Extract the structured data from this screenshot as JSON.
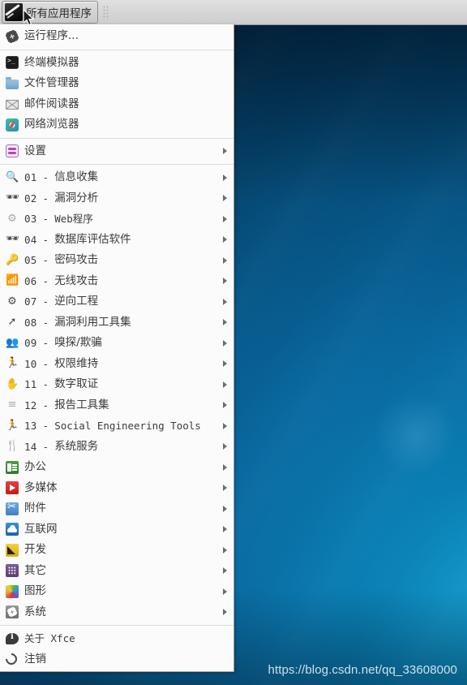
{
  "panel": {
    "button_label": "所有应用程序",
    "logo_icon": "kali-dragon-logo-icon",
    "grip_icon": "panel-grip-handle-icon"
  },
  "menu": {
    "run_program": {
      "label": "运行程序...",
      "icon": "gear-icon"
    },
    "favorites": [
      {
        "label": "终端模拟器",
        "icon": "terminal-icon"
      },
      {
        "label": "文件管理器",
        "icon": "folder-icon"
      },
      {
        "label": "邮件阅读器",
        "icon": "mail-envelope-icon"
      },
      {
        "label": "网络浏览器",
        "icon": "web-browser-compass-icon"
      }
    ],
    "settings": {
      "label": "设置",
      "icon": "settings-sliders-icon",
      "submenu": true
    },
    "kali_tools": [
      {
        "num": "01",
        "dash": "-",
        "label": "信息收集",
        "icon": "magnifier-icon",
        "submenu": true
      },
      {
        "num": "02",
        "dash": "-",
        "label": "漏洞分析",
        "icon": "bug-probe-icon",
        "submenu": true
      },
      {
        "num": "03",
        "dash": "-",
        "label": "Web程序",
        "icon": "web-gears-icon",
        "submenu": true
      },
      {
        "num": "04",
        "dash": "-",
        "label": "数据库评估软件",
        "icon": "bug-probe-icon",
        "submenu": true
      },
      {
        "num": "05",
        "dash": "-",
        "label": "密码攻击",
        "icon": "key-icon",
        "submenu": true
      },
      {
        "num": "06",
        "dash": "-",
        "label": "无线攻击",
        "icon": "wireless-icon",
        "submenu": true
      },
      {
        "num": "07",
        "dash": "-",
        "label": "逆向工程",
        "icon": "reverse-engineering-icon",
        "submenu": true
      },
      {
        "num": "08",
        "dash": "-",
        "label": "漏洞利用工具集",
        "icon": "exploit-icon",
        "submenu": true
      },
      {
        "num": "09",
        "dash": "-",
        "label": "嗅探/欺骗",
        "icon": "sniffing-icon",
        "submenu": true
      },
      {
        "num": "10",
        "dash": "-",
        "label": "权限维持",
        "icon": "running-person-icon",
        "submenu": true
      },
      {
        "num": "11",
        "dash": "-",
        "label": "数字取证",
        "icon": "hand-print-icon",
        "submenu": true
      },
      {
        "num": "12",
        "dash": "-",
        "label": "报告工具集",
        "icon": "report-document-icon",
        "submenu": true
      },
      {
        "num": "13",
        "dash": "-",
        "label": "Social Engineering Tools",
        "icon": "running-person-icon",
        "submenu": true
      },
      {
        "num": "14",
        "dash": "-",
        "label": "系统服务",
        "icon": "fork-knife-icon",
        "submenu": true
      }
    ],
    "categories": [
      {
        "label": "办公",
        "icon": "office-icon",
        "submenu": true
      },
      {
        "label": "多媒体",
        "icon": "multimedia-play-icon",
        "submenu": true
      },
      {
        "label": "附件",
        "icon": "accessories-scissors-icon",
        "submenu": true
      },
      {
        "label": "互联网",
        "icon": "internet-cloud-icon",
        "submenu": true
      },
      {
        "label": "开发",
        "icon": "development-icon",
        "submenu": true
      },
      {
        "label": "其它",
        "icon": "other-grid-icon",
        "submenu": true
      },
      {
        "label": "图形",
        "icon": "graphics-rainbow-icon",
        "submenu": true
      },
      {
        "label": "系统",
        "icon": "system-gear-icon",
        "submenu": true
      }
    ],
    "footer": [
      {
        "label": "关于 Xfce",
        "icon": "about-info-icon"
      },
      {
        "label": "注销",
        "icon": "logout-icon"
      }
    ]
  },
  "desktop": {
    "watermark": "https://blog.csdn.net/qq_33608000"
  },
  "colors": {
    "panel_bg": "#d6d6d6",
    "menu_bg": "#fbfbfb",
    "menu_text": "#3b3b3b",
    "wallpaper_blue": "#0a6ba2",
    "wallpaper_dark": "#03243c"
  }
}
